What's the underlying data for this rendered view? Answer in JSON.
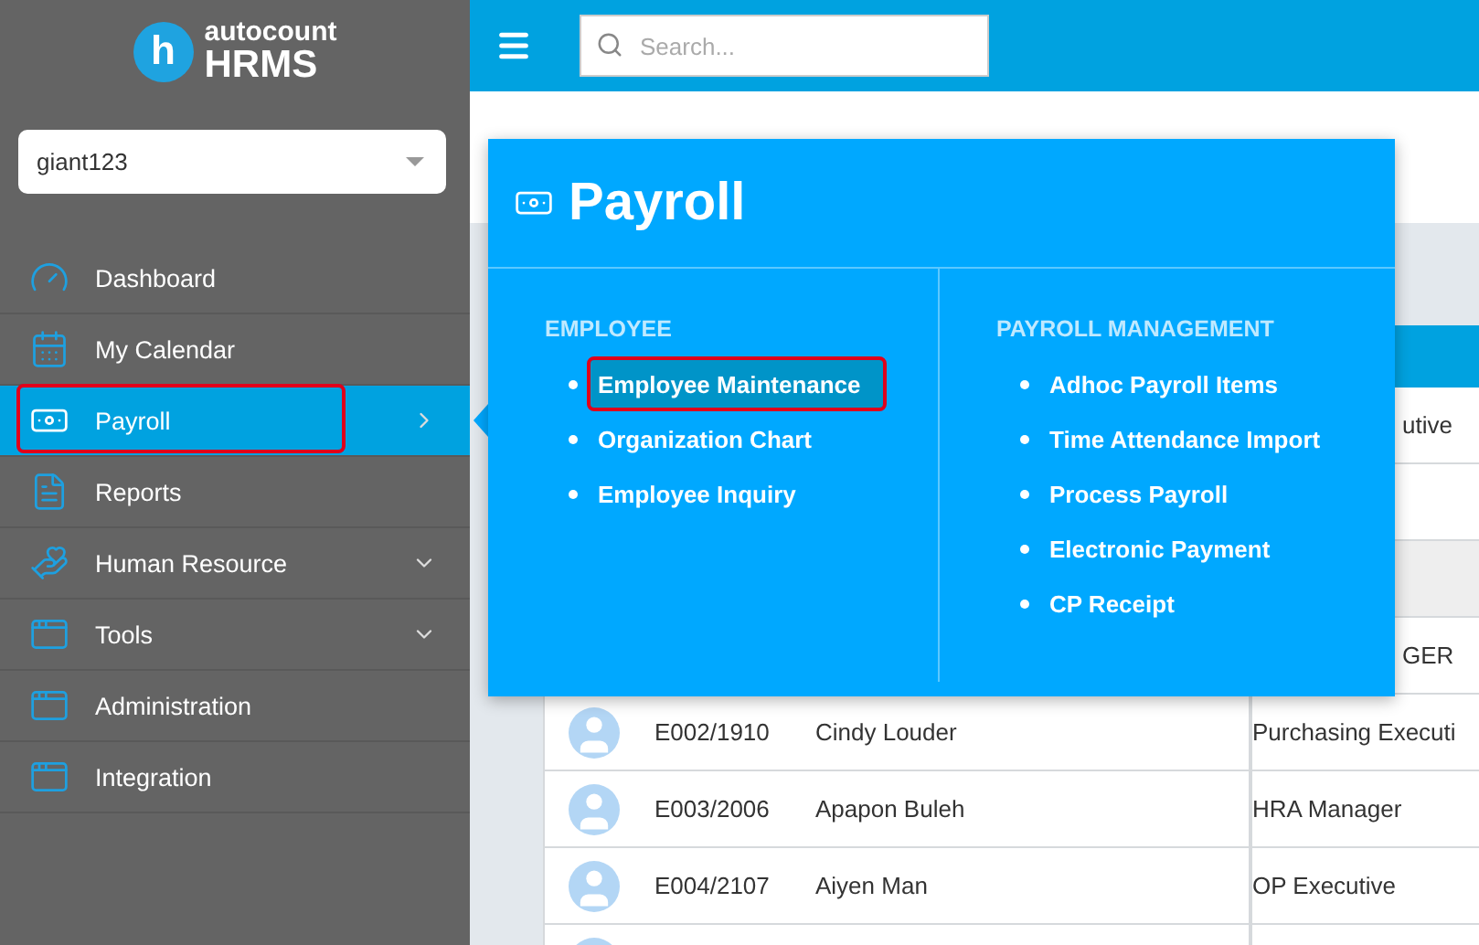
{
  "brand": {
    "small": "autocount",
    "big": "HRMS",
    "mark": "h"
  },
  "company_select": {
    "value": "giant123"
  },
  "sidebar": {
    "items": [
      {
        "label": "Dashboard",
        "selected": false,
        "outlined": false,
        "kind": "link"
      },
      {
        "label": "My Calendar",
        "selected": false,
        "outlined": false,
        "kind": "link"
      },
      {
        "label": "Payroll",
        "selected": true,
        "outlined": true,
        "kind": "flyout"
      },
      {
        "label": "Reports",
        "selected": false,
        "outlined": false,
        "kind": "link"
      },
      {
        "label": "Human Resource",
        "selected": false,
        "outlined": false,
        "kind": "expandable"
      },
      {
        "label": "Tools",
        "selected": false,
        "outlined": false,
        "kind": "expandable"
      },
      {
        "label": "Administration",
        "selected": false,
        "outlined": false,
        "kind": "link"
      },
      {
        "label": "Integration",
        "selected": false,
        "outlined": false,
        "kind": "link"
      }
    ]
  },
  "search": {
    "placeholder": "Search..."
  },
  "table": {
    "rows": [
      {
        "kind": "covered",
        "position": "utive",
        "shaded": false
      },
      {
        "kind": "covered",
        "position": "",
        "shaded": false
      },
      {
        "kind": "covered",
        "position": "",
        "shaded": true
      },
      {
        "kind": "covered",
        "position": "GER",
        "shaded": false
      },
      {
        "kind": "full",
        "id": "E002/1910",
        "name": "Cindy Louder",
        "position": "Purchasing Executi",
        "shaded": false
      },
      {
        "kind": "full",
        "id": "E003/2006",
        "name": "Apapon Buleh",
        "position": "HRA Manager",
        "shaded": false
      },
      {
        "kind": "full",
        "id": "E004/2107",
        "name": "Aiyen Man",
        "position": "OP Executive",
        "shaded": false
      },
      {
        "kind": "full",
        "id": "",
        "name": "",
        "position": "",
        "shaded": false
      }
    ]
  },
  "flyout": {
    "title": "Payroll",
    "sections": [
      {
        "heading": "EMPLOYEE",
        "items": [
          {
            "label": "Employee Maintenance",
            "selected": true,
            "outlined": true
          },
          {
            "label": "Organization Chart",
            "selected": false,
            "outlined": false
          },
          {
            "label": "Employee Inquiry",
            "selected": false,
            "outlined": false
          }
        ]
      },
      {
        "heading": "PAYROLL MANAGEMENT",
        "items": [
          {
            "label": "Adhoc Payroll Items",
            "selected": false,
            "outlined": false
          },
          {
            "label": "Time Attendance Import",
            "selected": false,
            "outlined": false
          },
          {
            "label": "Process Payroll",
            "selected": false,
            "outlined": false
          },
          {
            "label": "Electronic Payment",
            "selected": false,
            "outlined": false
          },
          {
            "label": "CP Receipt",
            "selected": false,
            "outlined": false
          }
        ]
      }
    ]
  }
}
